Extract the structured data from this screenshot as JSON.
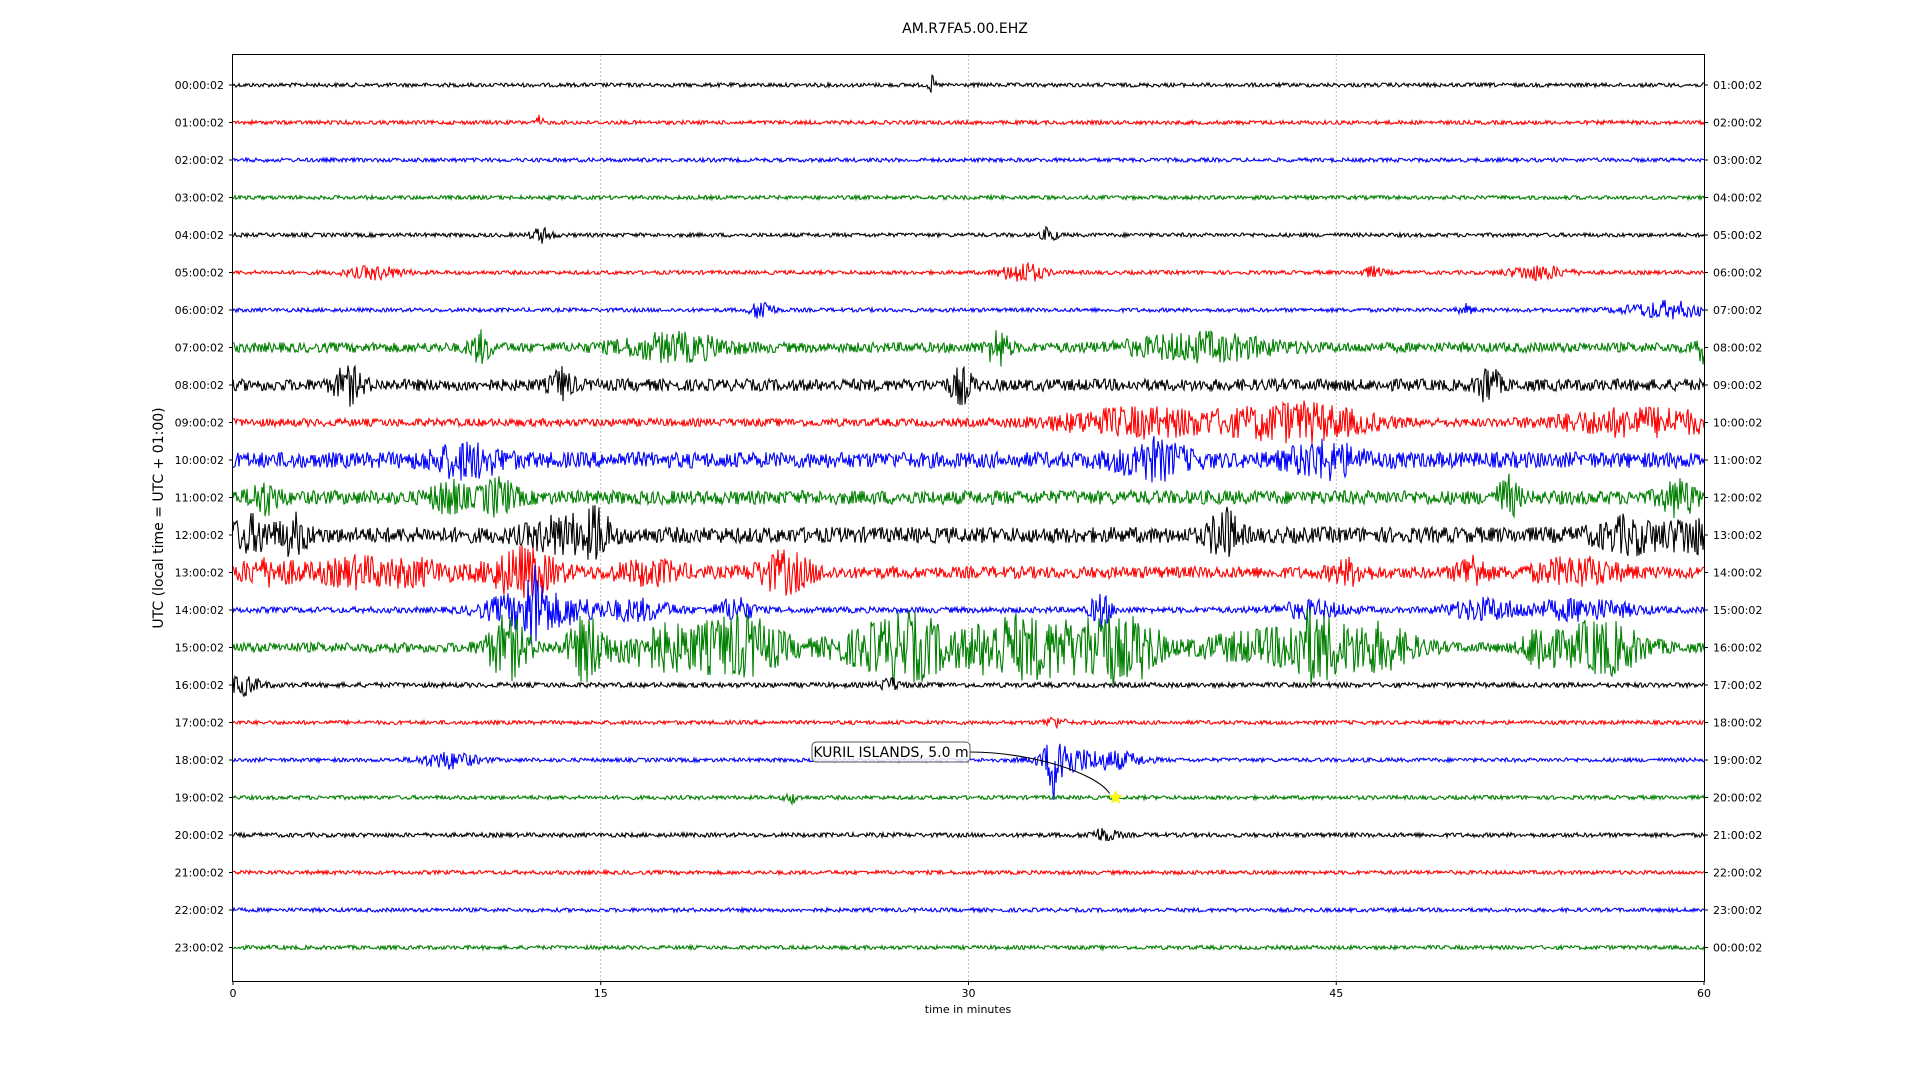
{
  "chart_data": {
    "type": "line",
    "title": "AM.R7FA5.00.EHZ",
    "xlabel": "time in minutes",
    "ylabel": "UTC (local time = UTC + 01:00)",
    "xlim": [
      0,
      60
    ],
    "xticks": [
      0,
      15,
      30,
      45,
      60
    ],
    "xtick_labels": [
      "0",
      "15",
      "30",
      "45",
      "60"
    ],
    "grid": "vertical",
    "colors": [
      "#000000",
      "#ff0000",
      "#0000ff",
      "#008000"
    ],
    "left_labels": [
      "00:00:02",
      "01:00:02",
      "02:00:02",
      "03:00:02",
      "04:00:02",
      "05:00:02",
      "06:00:02",
      "07:00:02",
      "08:00:02",
      "09:00:02",
      "10:00:02",
      "11:00:02",
      "12:00:02",
      "13:00:02",
      "14:00:02",
      "15:00:02",
      "16:00:02",
      "17:00:02",
      "18:00:02",
      "19:00:02",
      "20:00:02",
      "21:00:02",
      "22:00:02",
      "23:00:02"
    ],
    "right_labels": [
      "01:00:02",
      "02:00:02",
      "03:00:02",
      "04:00:02",
      "05:00:02",
      "06:00:02",
      "07:00:02",
      "08:00:02",
      "09:00:02",
      "10:00:02",
      "11:00:02",
      "12:00:02",
      "13:00:02",
      "14:00:02",
      "15:00:02",
      "16:00:02",
      "17:00:02",
      "18:00:02",
      "19:00:02",
      "20:00:02",
      "21:00:02",
      "22:00:02",
      "23:00:02",
      "00:00:02"
    ],
    "series": [
      {
        "noise": 2.0,
        "events": [
          {
            "t": 28.5,
            "amp": 8,
            "dur": 0.1
          }
        ]
      },
      {
        "noise": 2.0,
        "events": [
          {
            "t": 12.5,
            "amp": 6,
            "dur": 0.1
          }
        ]
      },
      {
        "noise": 2.0,
        "events": []
      },
      {
        "noise": 2.0,
        "events": []
      },
      {
        "noise": 2.0,
        "events": [
          {
            "t": 12.6,
            "amp": 7,
            "dur": 0.3
          },
          {
            "t": 33.3,
            "amp": 8,
            "dur": 0.2
          }
        ]
      },
      {
        "noise": 2.0,
        "events": [
          {
            "t": 5.8,
            "amp": 6,
            "dur": 0.8
          },
          {
            "t": 32.2,
            "amp": 10,
            "dur": 0.6
          },
          {
            "t": 46.5,
            "amp": 5,
            "dur": 0.3
          },
          {
            "t": 53.2,
            "amp": 7,
            "dur": 0.8
          }
        ]
      },
      {
        "noise": 2.0,
        "events": [
          {
            "t": 21.6,
            "amp": 11,
            "dur": 0.3
          },
          {
            "t": 50.3,
            "amp": 5,
            "dur": 0.2
          },
          {
            "t": 58.5,
            "amp": 8,
            "dur": 1.2
          }
        ]
      },
      {
        "noise": 5.0,
        "events": [
          {
            "t": 10.1,
            "amp": 14,
            "dur": 0.3
          },
          {
            "t": 18.0,
            "amp": 12,
            "dur": 1.5
          },
          {
            "t": 31.2,
            "amp": 18,
            "dur": 0.3
          },
          {
            "t": 39.5,
            "amp": 12,
            "dur": 2.0
          },
          {
            "t": 60.0,
            "amp": 13,
            "dur": 0.3
          }
        ]
      },
      {
        "noise": 6.0,
        "events": [
          {
            "t": 4.7,
            "amp": 16,
            "dur": 0.4
          },
          {
            "t": 13.4,
            "amp": 14,
            "dur": 0.3
          },
          {
            "t": 29.7,
            "amp": 16,
            "dur": 0.3
          },
          {
            "t": 51.2,
            "amp": 18,
            "dur": 0.3
          }
        ]
      },
      {
        "noise": 4.0,
        "events": [
          {
            "t": 37.0,
            "amp": 13,
            "dur": 2.5
          },
          {
            "t": 43.5,
            "amp": 18,
            "dur": 2.0
          },
          {
            "t": 57.5,
            "amp": 13,
            "dur": 2.5
          }
        ]
      },
      {
        "noise": 8.0,
        "events": [
          {
            "t": 9.5,
            "amp": 14,
            "dur": 1.0
          },
          {
            "t": 37.5,
            "amp": 16,
            "dur": 1.0
          },
          {
            "t": 44.5,
            "amp": 15,
            "dur": 1.0
          }
        ]
      },
      {
        "noise": 7.0,
        "events": [
          {
            "t": 1.3,
            "amp": 14,
            "dur": 0.4
          },
          {
            "t": 8.8,
            "amp": 14,
            "dur": 0.5
          },
          {
            "t": 10.8,
            "amp": 16,
            "dur": 0.5
          },
          {
            "t": 52.0,
            "amp": 18,
            "dur": 0.3
          },
          {
            "t": 59.0,
            "amp": 16,
            "dur": 0.5
          }
        ]
      },
      {
        "noise": 8.0,
        "events": [
          {
            "t": 0.8,
            "amp": 14,
            "dur": 0.6
          },
          {
            "t": 2.5,
            "amp": 16,
            "dur": 0.4
          },
          {
            "t": 13.5,
            "amp": 16,
            "dur": 1.0
          },
          {
            "t": 14.9,
            "amp": 20,
            "dur": 0.3
          },
          {
            "t": 40.4,
            "amp": 24,
            "dur": 0.4
          },
          {
            "t": 57.0,
            "amp": 14,
            "dur": 1.0
          },
          {
            "t": 59.5,
            "amp": 15,
            "dur": 0.6
          }
        ]
      },
      {
        "noise": 6.0,
        "events": [
          {
            "t": 1.5,
            "amp": 10,
            "dur": 1.0
          },
          {
            "t": 5.0,
            "amp": 12,
            "dur": 1.0
          },
          {
            "t": 7.5,
            "amp": 10,
            "dur": 1.0
          },
          {
            "t": 11.8,
            "amp": 22,
            "dur": 1.0
          },
          {
            "t": 17.0,
            "amp": 10,
            "dur": 1.0
          },
          {
            "t": 22.5,
            "amp": 18,
            "dur": 0.8
          },
          {
            "t": 45.5,
            "amp": 10,
            "dur": 0.5
          },
          {
            "t": 50.5,
            "amp": 16,
            "dur": 0.4
          },
          {
            "t": 54.8,
            "amp": 12,
            "dur": 1.2
          }
        ]
      },
      {
        "noise": 3.0,
        "events": [
          {
            "t": 11.5,
            "amp": 14,
            "dur": 1.0
          },
          {
            "t": 12.3,
            "amp": 30,
            "dur": 0.3
          },
          {
            "t": 13.5,
            "amp": 12,
            "dur": 1.0
          },
          {
            "t": 16.5,
            "amp": 10,
            "dur": 1.0
          },
          {
            "t": 20.5,
            "amp": 12,
            "dur": 0.5
          },
          {
            "t": 35.4,
            "amp": 16,
            "dur": 0.3
          },
          {
            "t": 44.0,
            "amp": 8,
            "dur": 1.0
          },
          {
            "t": 51.0,
            "amp": 10,
            "dur": 1.0
          },
          {
            "t": 55.0,
            "amp": 10,
            "dur": 1.5
          }
        ]
      },
      {
        "noise": 5.0,
        "events": [
          {
            "t": 11.2,
            "amp": 30,
            "dur": 0.6
          },
          {
            "t": 14.4,
            "amp": 30,
            "dur": 0.5
          },
          {
            "t": 17.5,
            "amp": 20,
            "dur": 1.5
          },
          {
            "t": 20.8,
            "amp": 28,
            "dur": 1.2
          },
          {
            "t": 26.5,
            "amp": 20,
            "dur": 1.5
          },
          {
            "t": 28.0,
            "amp": 18,
            "dur": 1.0
          },
          {
            "t": 31.0,
            "amp": 20,
            "dur": 1.0
          },
          {
            "t": 33.4,
            "amp": 26,
            "dur": 1.5
          },
          {
            "t": 35.5,
            "amp": 30,
            "dur": 0.5
          },
          {
            "t": 37.0,
            "amp": 26,
            "dur": 0.6
          },
          {
            "t": 42.0,
            "amp": 14,
            "dur": 2.0
          },
          {
            "t": 44.0,
            "amp": 26,
            "dur": 0.7
          },
          {
            "t": 46.5,
            "amp": 22,
            "dur": 1.2
          },
          {
            "t": 53.3,
            "amp": 24,
            "dur": 0.4
          },
          {
            "t": 55.8,
            "amp": 26,
            "dur": 1.2
          }
        ]
      },
      {
        "noise": 2.5,
        "events": [
          {
            "t": 0.4,
            "amp": 9,
            "dur": 0.5
          },
          {
            "t": 26.8,
            "amp": 6,
            "dur": 0.3
          }
        ]
      },
      {
        "noise": 2.0,
        "events": [
          {
            "t": 33.5,
            "amp": 5,
            "dur": 0.3
          }
        ]
      },
      {
        "noise": 2.0,
        "events": [
          {
            "t": 8.8,
            "amp": 8,
            "dur": 0.8
          },
          {
            "t": 33.6,
            "amp": 34,
            "dur": 0.25
          },
          {
            "t": 34.0,
            "amp": 12,
            "dur": 0.8
          },
          {
            "t": 36.0,
            "amp": 8,
            "dur": 0.8
          }
        ]
      },
      {
        "noise": 2.0,
        "events": [
          {
            "t": 22.8,
            "amp": 5,
            "dur": 0.2
          }
        ]
      },
      {
        "noise": 2.2,
        "events": [
          {
            "t": 35.5,
            "amp": 6,
            "dur": 0.4
          }
        ]
      },
      {
        "noise": 2.0,
        "events": []
      },
      {
        "noise": 2.0,
        "events": []
      },
      {
        "noise": 2.0,
        "events": []
      }
    ],
    "annotations": [
      {
        "text": "KURIL ISLANDS, 5.0 m",
        "event_minute": 36.0,
        "trace": 19,
        "marker": "star",
        "marker_color": "#ffff00"
      }
    ]
  }
}
